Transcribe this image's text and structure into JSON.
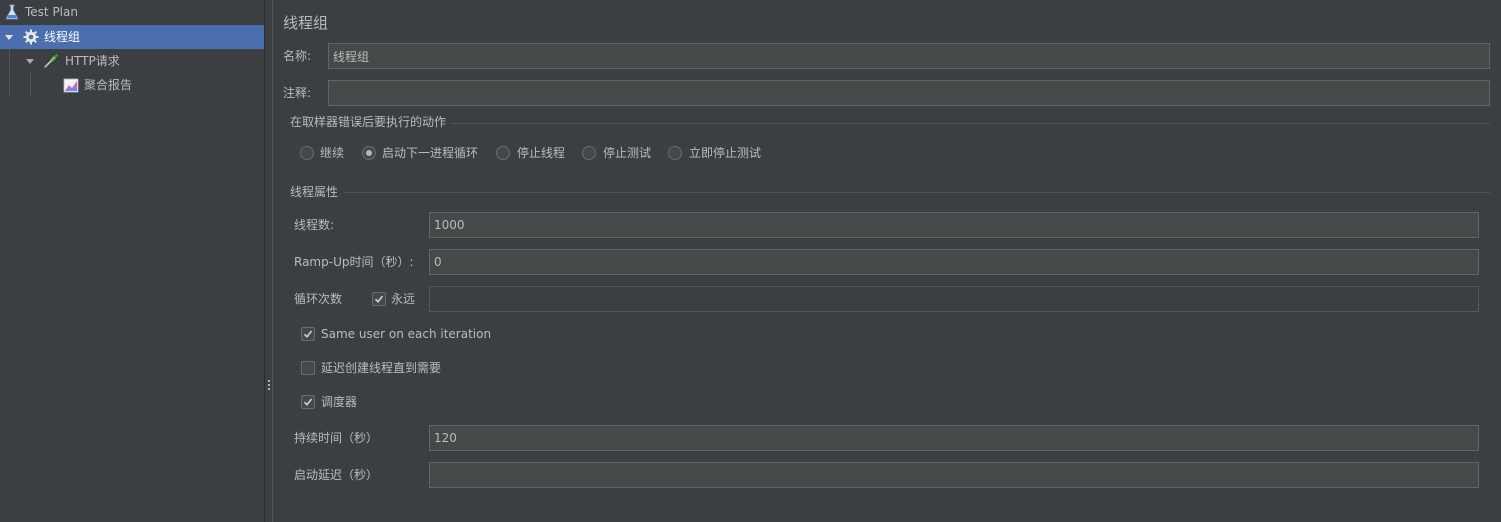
{
  "tree": {
    "items": [
      {
        "label": "Test Plan",
        "icon": "flask-icon"
      },
      {
        "label": "线程组",
        "icon": "gear-icon",
        "selected": true,
        "expanded": true
      },
      {
        "label": "HTTP请求",
        "icon": "pipette-icon",
        "expanded": true
      },
      {
        "label": "聚合报告",
        "icon": "chart-icon"
      }
    ]
  },
  "panel": {
    "title": "线程组",
    "name_label": "名称:",
    "name_value": "线程组",
    "comment_label": "注释:",
    "comment_value": ""
  },
  "error_action": {
    "section_title": "在取样器错误后要执行的动作",
    "options": [
      {
        "label": "继续",
        "selected": false
      },
      {
        "label": "启动下一进程循环",
        "selected": true
      },
      {
        "label": "停止线程",
        "selected": false
      },
      {
        "label": "停止测试",
        "selected": false
      },
      {
        "label": "立即停止测试",
        "selected": false
      }
    ]
  },
  "thread_props": {
    "section_title": "线程属性",
    "num_threads_label": "线程数:",
    "num_threads_value": "1000",
    "ramp_up_label": "Ramp-Up时间（秒）:",
    "ramp_up_value": "0",
    "loop_label": "循环次数",
    "forever_label": "永远",
    "forever_checked": true,
    "loop_value": "",
    "same_user_label": "Same user on each iteration",
    "same_user_checked": true,
    "delay_create_label": "延迟创建线程直到需要",
    "delay_create_checked": false,
    "scheduler_label": "调度器",
    "scheduler_checked": true,
    "duration_label": "持续时间（秒）",
    "duration_value": "120",
    "startup_delay_label": "启动延迟（秒）",
    "startup_delay_value": ""
  },
  "colors": {
    "background": "#3c3f41",
    "selection": "#4b6eaf",
    "field_bg": "#45494a",
    "text": "#bbbbbb"
  }
}
